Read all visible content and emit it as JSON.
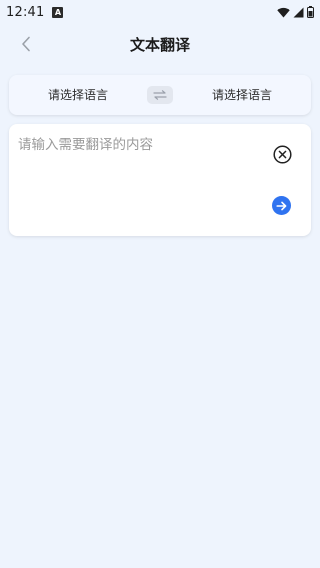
{
  "status_bar": {
    "time": "12:41",
    "notification_badge": "A",
    "icons": [
      "wifi-icon",
      "signal-icon",
      "battery-icon"
    ]
  },
  "header": {
    "title": "文本翻译",
    "back_icon": "chevron-left-icon"
  },
  "language_selector": {
    "source_label": "请选择语言",
    "target_label": "请选择语言",
    "swap_icon": "swap-arrows-icon"
  },
  "input": {
    "placeholder": "请输入需要翻译的内容",
    "value": "",
    "clear_icon": "clear-circle-icon",
    "submit_icon": "arrow-right-circle-icon"
  },
  "colors": {
    "background": "#eef4fd",
    "accent": "#2f73f0",
    "card": "#ffffff"
  }
}
